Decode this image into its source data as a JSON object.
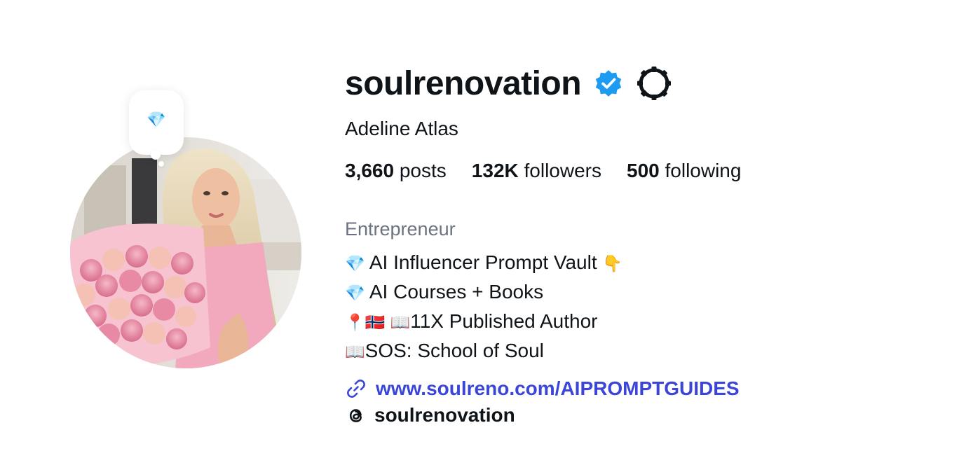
{
  "profile": {
    "username": "soulrenovation",
    "verified": true,
    "full_name": "Adeline Atlas",
    "note_emoji": "💎",
    "stats": [
      {
        "number": "3,660",
        "label": "posts"
      },
      {
        "number": "132K",
        "label": "followers"
      },
      {
        "number": "500",
        "label": "following"
      }
    ],
    "category": "Entrepreneur",
    "bio": [
      {
        "prefix": "💎",
        "text": "AI Influencer Prompt Vault",
        "suffix": "👇"
      },
      {
        "prefix": "💎",
        "text": "AI Courses + Books",
        "suffix": ""
      },
      {
        "prefix": "📍🇳🇴 📖",
        "text": "11X Published Author",
        "suffix": ""
      },
      {
        "prefix": "📖",
        "text": "SOS: School of Soul",
        "suffix": ""
      }
    ],
    "link": "www.soulreno.com/AIPROMPTGUIDES",
    "threads_handle": "soulrenovation"
  },
  "colors": {
    "verified_badge": "#1d9bf0",
    "link": "#3b46d8",
    "category": "#6b7280",
    "text": "#0f1419"
  },
  "icons": {
    "verified": "verified-badge-icon",
    "settings": "gear-icon",
    "link": "link-chain-icon",
    "threads": "threads-logo-icon"
  }
}
